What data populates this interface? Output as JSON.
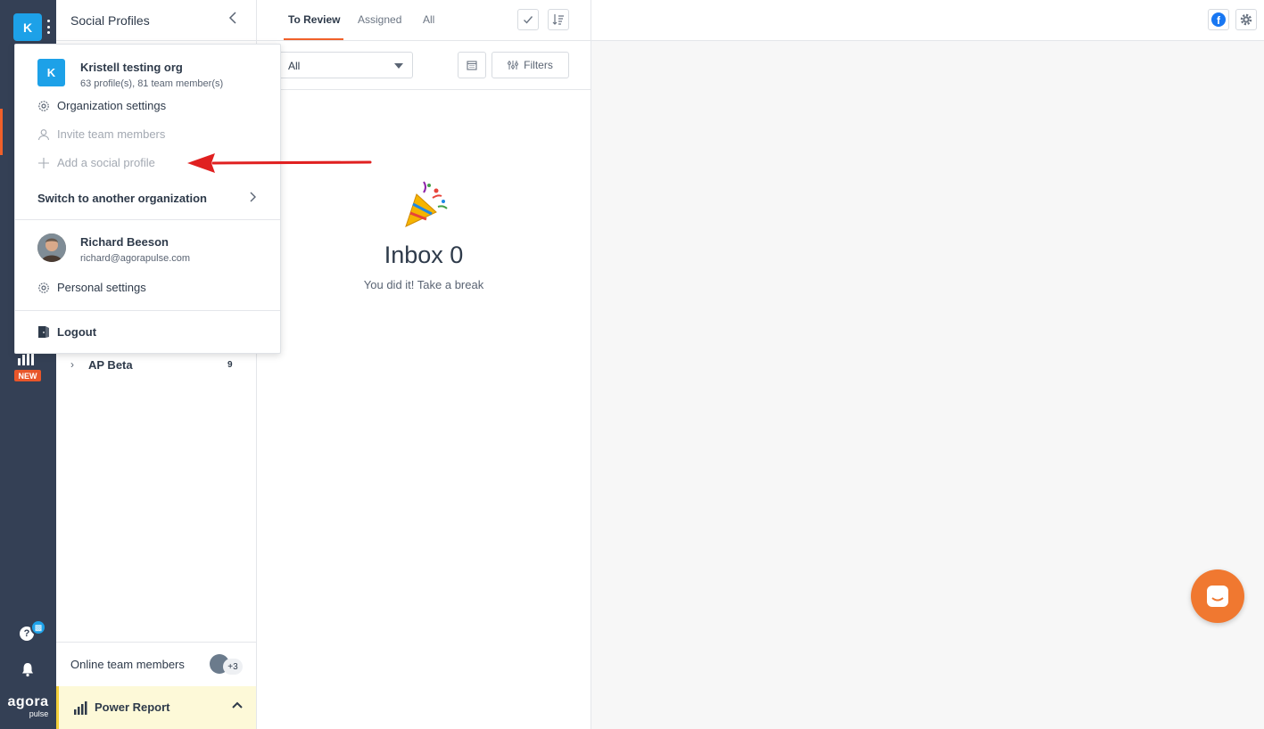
{
  "rail": {
    "org_initial": "K",
    "new_badge": "NEW",
    "help_glyph": "?",
    "brand_line1": "agora",
    "brand_line2": "pulse"
  },
  "sidebar": {
    "title": "Social Profiles",
    "groups": [
      {
        "name": "AP Beta",
        "count": "9"
      }
    ],
    "online_label": "Online team members",
    "online_extra": "+3",
    "power_report_label": "Power Report"
  },
  "inbox": {
    "tabs": [
      {
        "label": "To Review",
        "active": true
      },
      {
        "label": "Assigned",
        "active": false
      },
      {
        "label": "All",
        "active": false
      }
    ],
    "filter_select_value": "All",
    "filters_label": "Filters",
    "empty_title": "Inbox 0",
    "empty_subtitle": "You did it! Take a break"
  },
  "dropdown": {
    "org": {
      "initial": "K",
      "name": "Kristell testing org",
      "meta": "63 profile(s), 81 team member(s)"
    },
    "org_items": [
      {
        "label": "Organization settings",
        "icon": "gear-icon",
        "disabled": false
      },
      {
        "label": "Invite team members",
        "icon": "user-icon",
        "disabled": true
      },
      {
        "label": "Add a social profile",
        "icon": "plus-icon",
        "disabled": true
      }
    ],
    "switch_label": "Switch to another organization",
    "user": {
      "name": "Richard Beeson",
      "email": "richard@agorapulse.com"
    },
    "personal_settings_label": "Personal settings",
    "logout_label": "Logout"
  },
  "colors": {
    "rail_bg": "#344055",
    "accent_orange": "#f0602a",
    "org_blue": "#1da1e8",
    "annotation_red": "#e02020",
    "chat_orange": "#f07830"
  }
}
